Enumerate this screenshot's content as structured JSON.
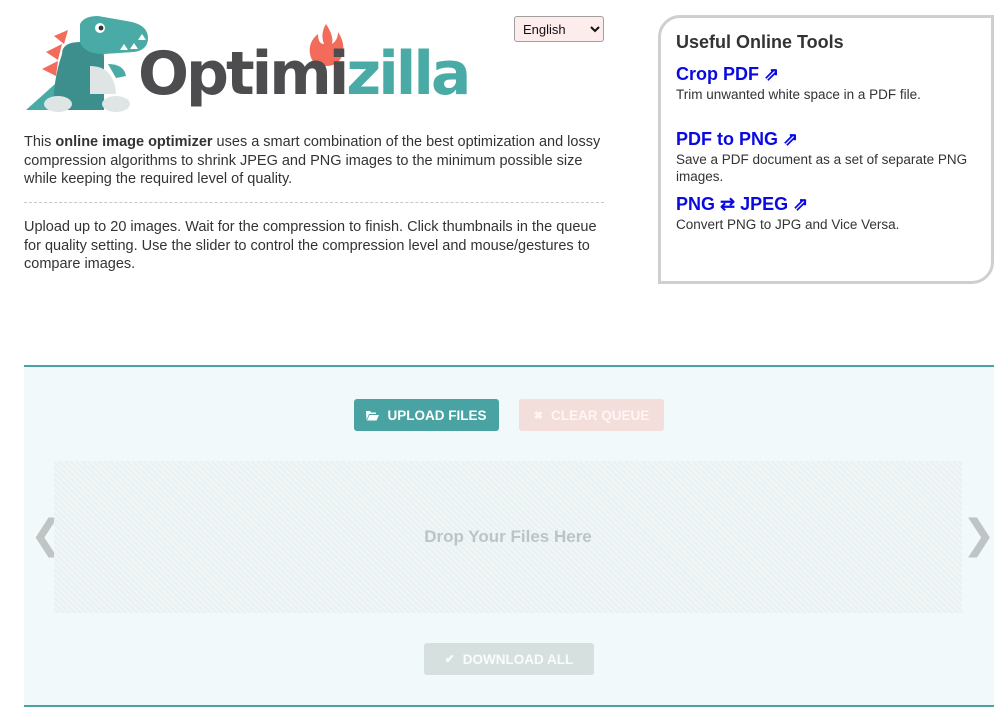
{
  "logo": {
    "part1": "Optimi",
    "part2": "zilla"
  },
  "language": {
    "selected": "English",
    "options": [
      "English"
    ]
  },
  "intro": {
    "p1_pre": "This ",
    "p1_bold": "online image optimizer",
    "p1_post": " uses a smart combination of the best optimization and lossy compression algorithms to shrink JPEG and PNG images to the minimum possible size while keeping the required level of quality.",
    "p2": "Upload up to 20 images. Wait for the compression to finish. Click thumbnails in the queue for quality setting. Use the slider to control the compression level and mouse/gestures to compare images."
  },
  "tools": {
    "heading": "Useful Online Tools",
    "items": [
      {
        "title": "Crop PDF ⇗",
        "desc": "Trim unwanted white space in a PDF file."
      },
      {
        "title": "PDF to PNG ⇗",
        "desc": "Save a PDF document as a set of separate PNG images."
      },
      {
        "title": "PNG ⇄ JPEG ⇗",
        "desc": "Convert PNG to JPG and Vice Versa."
      }
    ]
  },
  "upload_area": {
    "upload_label": "UPLOAD FILES",
    "clear_label": "CLEAR QUEUE",
    "drop_text": "Drop Your Files Here",
    "download_label": "DOWNLOAD ALL",
    "prev_arrow": "❮",
    "next_arrow": "❯"
  },
  "icons": {
    "upload": "folder-open-icon",
    "clear": "x-icon",
    "download": "checkmark-icon"
  },
  "colors": {
    "accent": "#4aa3a3",
    "logo_dark": "#4d4d4f",
    "logo_teal": "#4aaba6",
    "flame": "#f26b5b",
    "link": "#0a0ae0"
  }
}
